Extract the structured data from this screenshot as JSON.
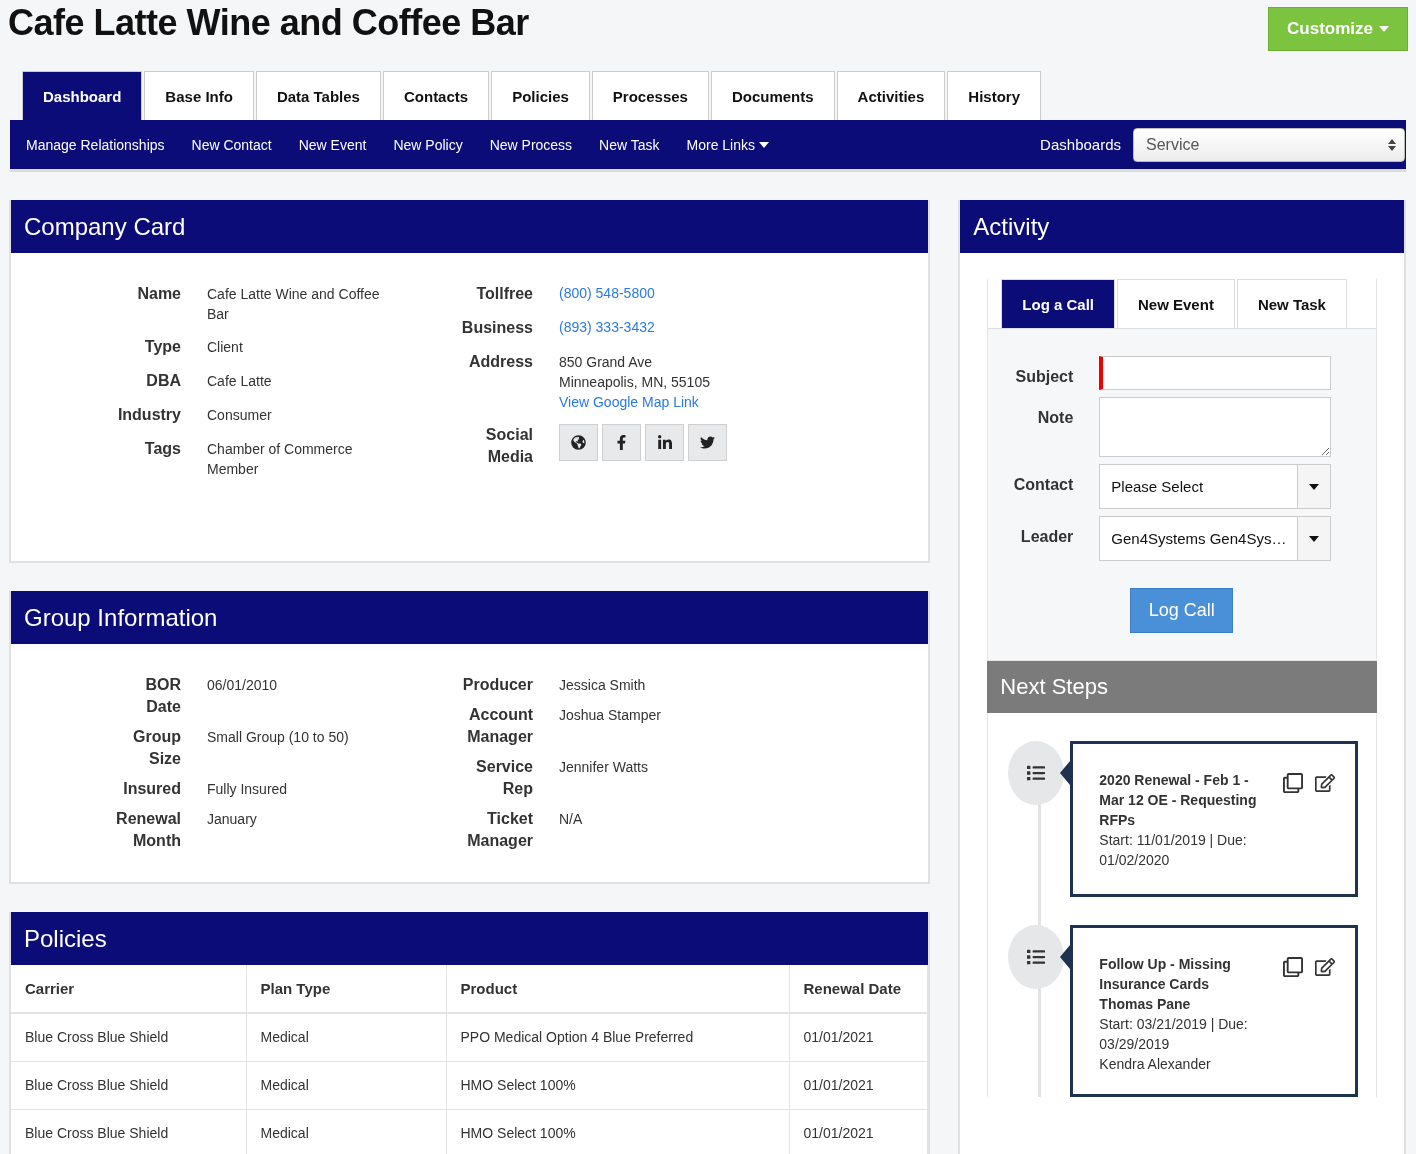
{
  "title": "Cafe Latte Wine and Coffee Bar",
  "customize_button": "Customize",
  "tabs": [
    {
      "label": "Dashboard",
      "selected": true
    },
    {
      "label": "Base Info",
      "selected": false
    },
    {
      "label": "Data Tables",
      "selected": false
    },
    {
      "label": "Contacts",
      "selected": false
    },
    {
      "label": "Policies",
      "selected": false
    },
    {
      "label": "Processes",
      "selected": false
    },
    {
      "label": "Documents",
      "selected": false
    },
    {
      "label": "Activities",
      "selected": false
    },
    {
      "label": "History",
      "selected": false
    }
  ],
  "subnav": {
    "links": [
      "Manage Relationships",
      "New Contact",
      "New Event",
      "New Policy",
      "New Process",
      "New Task"
    ],
    "more_links": "More Links",
    "dashboards_label": "Dashboards",
    "dashboards_value": "Service"
  },
  "company_card": {
    "title": "Company Card",
    "left_fields": [
      {
        "label": "Name",
        "value": "Cafe Latte Wine and Coffee Bar"
      },
      {
        "label": "Type",
        "value": "Client"
      },
      {
        "label": "DBA",
        "value": "Cafe Latte"
      },
      {
        "label": "Industry",
        "value": "Consumer"
      },
      {
        "label": "Tags",
        "value": "Chamber of Commerce Member"
      }
    ],
    "right_fields": [
      {
        "kind": "phone",
        "label": "Tollfree",
        "value": "(800) 548-5800"
      },
      {
        "kind": "phone",
        "label": "Business",
        "value": "(893) 333-3432"
      },
      {
        "kind": "address",
        "label": "Address",
        "lines": [
          "850 Grand Ave",
          "Minneapolis, MN, 55105"
        ],
        "link": "View Google Map Link"
      },
      {
        "kind": "social",
        "label": "Social Media"
      }
    ]
  },
  "group_information": {
    "title": "Group Information",
    "left_fields": [
      {
        "label": "BOR Date",
        "value": "06/01/2010"
      },
      {
        "label": "Group Size",
        "value": "Small Group (10 to 50)"
      },
      {
        "label": "Insured",
        "value": "Fully Insured"
      },
      {
        "label": "Renewal Month",
        "value": "January"
      }
    ],
    "right_fields": [
      {
        "label": "Producer",
        "value": "Jessica Smith"
      },
      {
        "label": "Account Manager",
        "value": "Joshua Stamper"
      },
      {
        "label": "Service Rep",
        "value": "Jennifer Watts"
      },
      {
        "label": "Ticket Manager",
        "value": "N/A"
      }
    ]
  },
  "policies": {
    "title": "Policies",
    "columns": [
      "Carrier",
      "Plan Type",
      "Product",
      "Renewal Date"
    ],
    "rows": [
      [
        "Blue Cross Blue Shield",
        "Medical",
        "PPO Medical Option 4 Blue Preferred",
        "01/01/2021"
      ],
      [
        "Blue Cross Blue Shield",
        "Medical",
        "HMO Select 100%",
        "01/01/2021"
      ],
      [
        "Blue Cross Blue Shield",
        "Medical",
        "HMO Select 100%",
        "01/01/2021"
      ]
    ]
  },
  "activity": {
    "title": "Activity",
    "tabs": [
      {
        "label": "Log a Call",
        "selected": true
      },
      {
        "label": "New Event",
        "selected": false
      },
      {
        "label": "New Task",
        "selected": false
      }
    ],
    "form": {
      "subject_label": "Subject",
      "note_label": "Note",
      "contact_label": "Contact",
      "contact_value": "Please Select",
      "leader_label": "Leader",
      "leader_value": "Gen4Systems Gen4Sys…",
      "submit": "Log Call"
    },
    "next_steps_title": "Next Steps",
    "steps": [
      {
        "title": "2020 Renewal - Feb 1 - Mar 12 OE - Requesting RFPs",
        "dates": "Start: 11/01/2019 | Due: 01/02/2020"
      },
      {
        "title": "Follow Up - Missing Insurance Cards",
        "contact": "Thomas Pane",
        "dates": "Start: 03/21/2019 | Due: 03/29/2019",
        "owner": "Kendra Alexander"
      }
    ]
  }
}
